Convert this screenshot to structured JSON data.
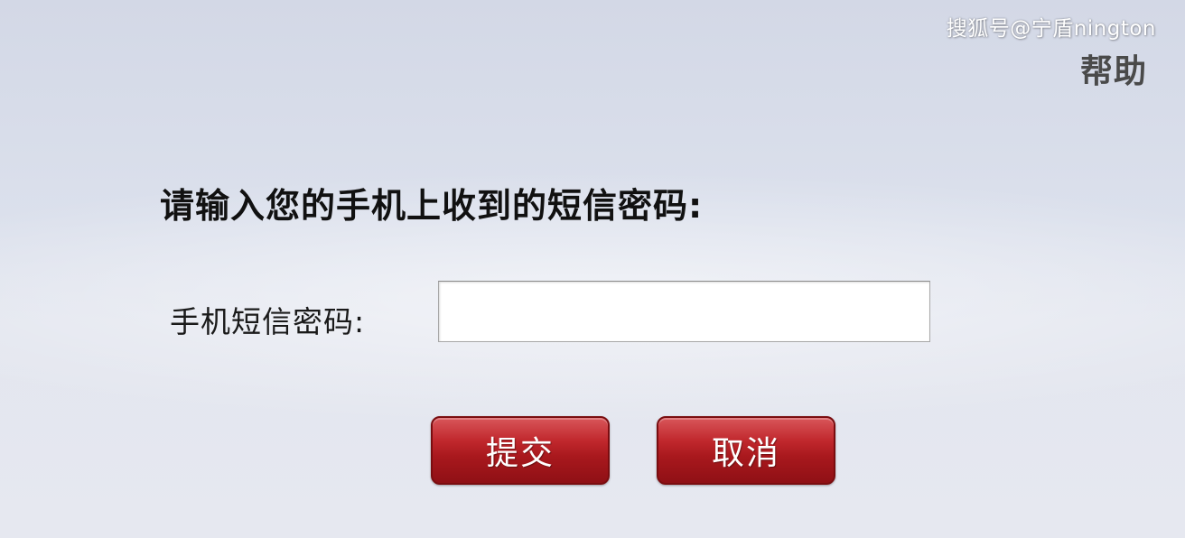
{
  "watermark": "搜狐号@宁盾nington",
  "header": {
    "help_label": "帮助"
  },
  "form": {
    "prompt": "请输入您的手机上收到的短信密码:",
    "sms_code_label": "手机短信密码:",
    "sms_code_value": "",
    "submit_label": "提交",
    "cancel_label": "取消"
  },
  "colors": {
    "button_red": "#b01c21",
    "background": "#dbe0ec"
  }
}
